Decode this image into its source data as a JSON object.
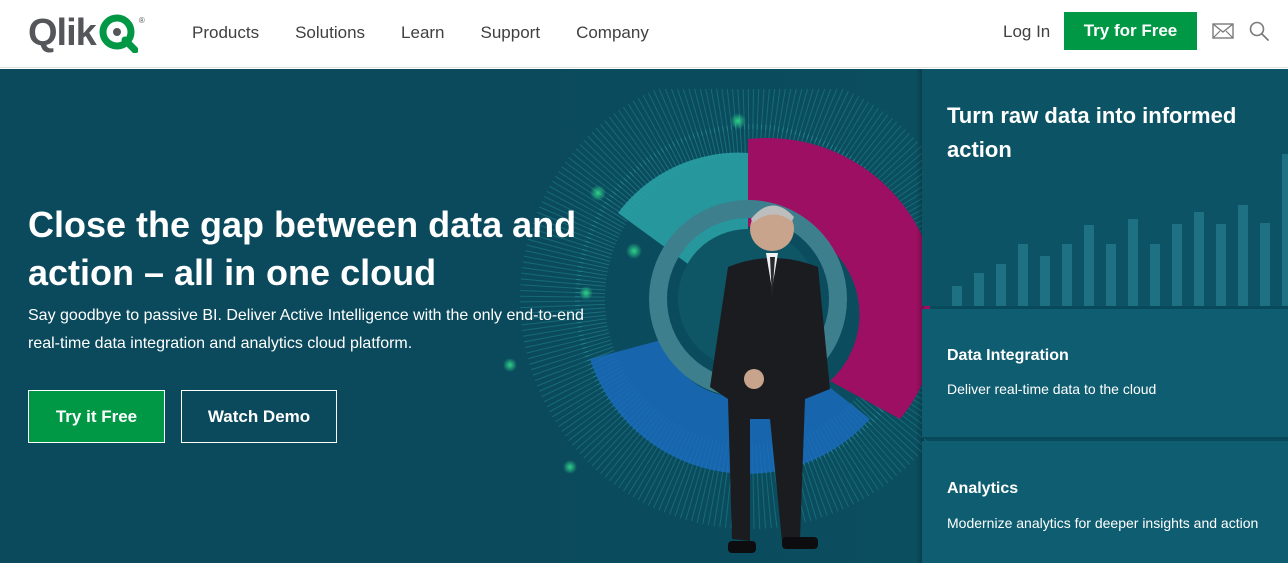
{
  "header": {
    "logo_text": "Qlik",
    "logo_q": "Q",
    "logo_mark": "®",
    "nav": [
      "Products",
      "Solutions",
      "Learn",
      "Support",
      "Company"
    ],
    "login_label": "Log In",
    "try_label": "Try for Free",
    "icons": {
      "mail": "mail-icon",
      "search": "search-icon"
    }
  },
  "hero": {
    "title": "Close the gap between data and action – all in one cloud",
    "subtitle": "Say goodbye to passive BI. Deliver Active Intelligence with the only end-to-end real-time data integration and analytics cloud platform.",
    "try_button": "Try it Free",
    "demo_button": "Watch Demo"
  },
  "panels": {
    "top_title": "Turn raw data into informed action",
    "cards": [
      {
        "title": "Data Integration",
        "desc": "Deliver real-time data to the cloud"
      },
      {
        "title": "Analytics",
        "desc": "Modernize analytics for deeper insights and action"
      }
    ]
  },
  "colors": {
    "brand_green": "#009845",
    "hero_bg": "#084a5b",
    "magenta": "#9c0f62",
    "teal": "#2aa5a8",
    "blue": "#1a6cc0"
  }
}
